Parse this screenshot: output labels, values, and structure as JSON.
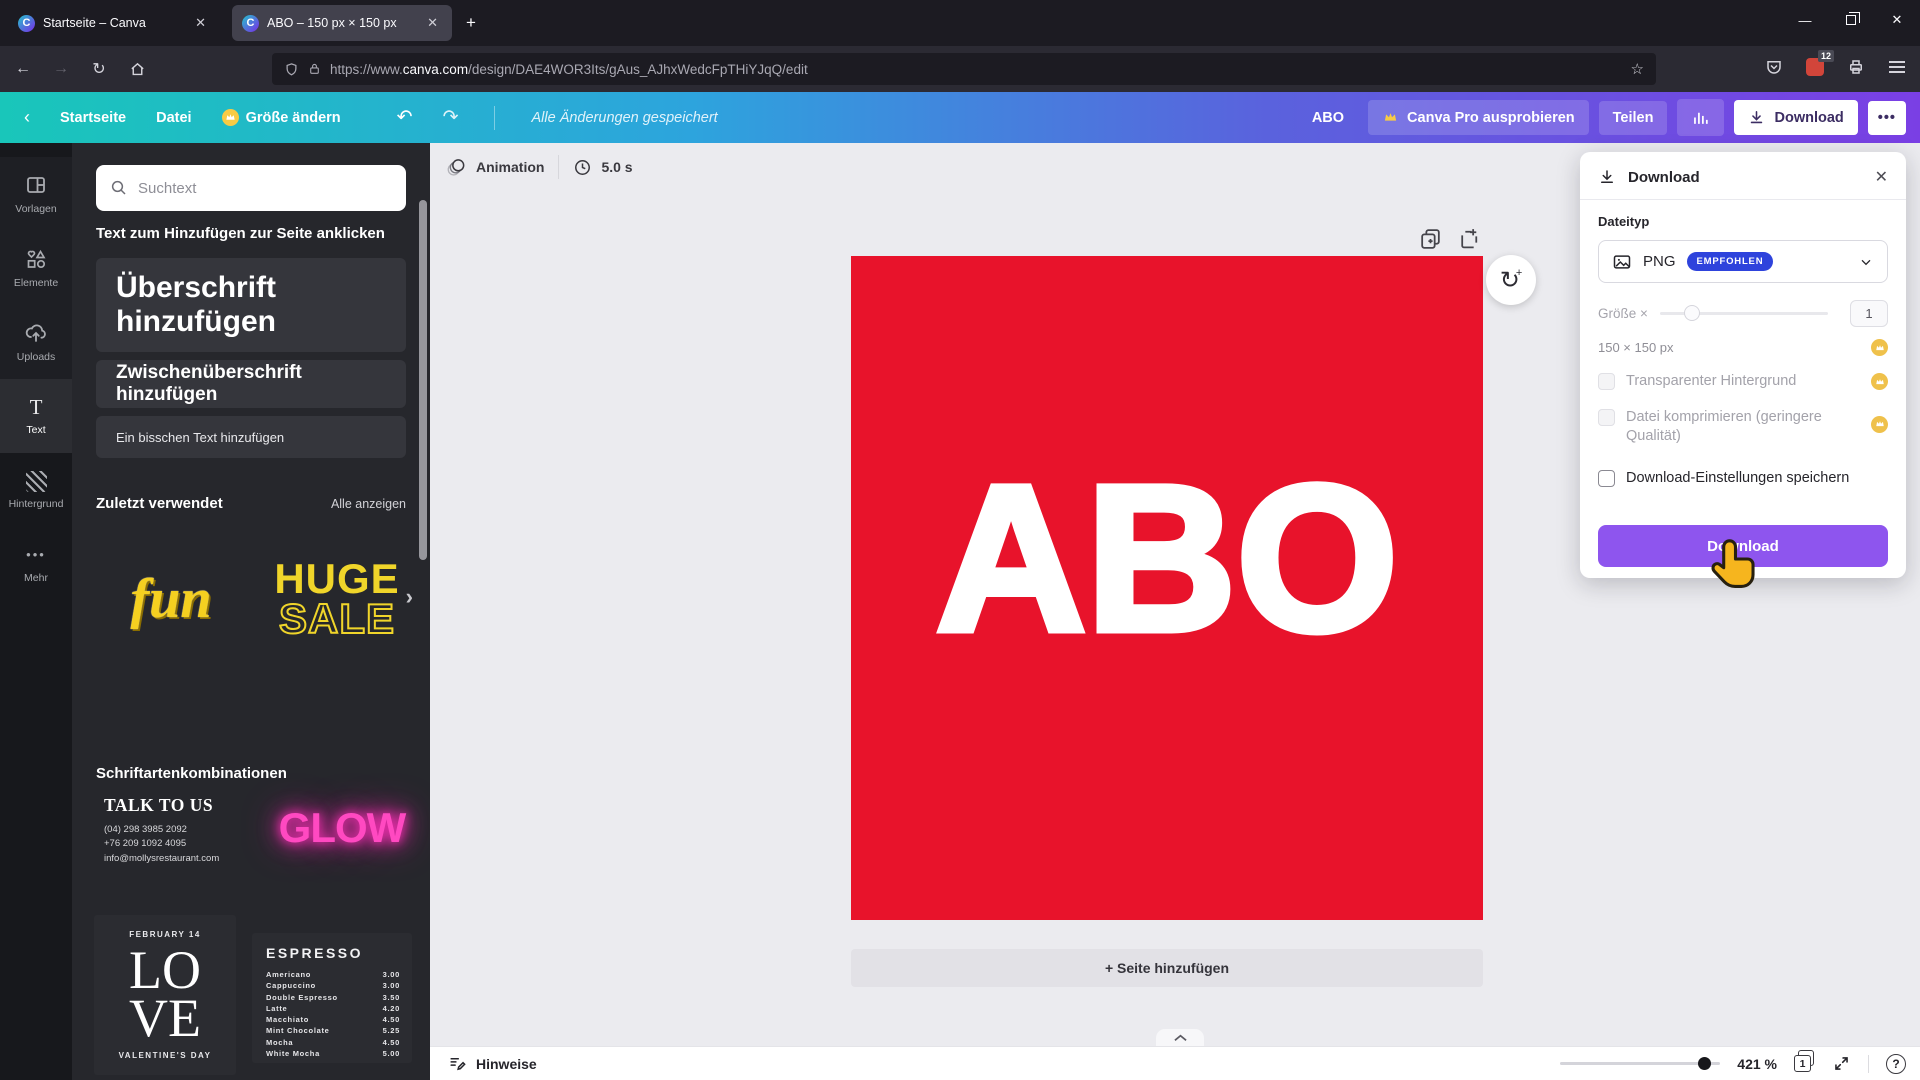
{
  "browser": {
    "tab1": "Startseite – Canva",
    "tab2": "ABO – 150 px × 150 px",
    "url_prefix": "https://www.",
    "url_domain": "canva.com",
    "url_path": "/design/DAE4WOR3Its/gAus_AJhxWedcFpTHiYJqQ/edit",
    "ext_badge": "12"
  },
  "topbar": {
    "home": "Startseite",
    "file": "Datei",
    "resize": "Größe ändern",
    "saved": "Alle Änderungen gespeichert",
    "design_name": "ABO",
    "try_pro": "Canva Pro ausprobieren",
    "share": "Teilen",
    "download": "Download",
    "more": "•••"
  },
  "rail": {
    "items": [
      {
        "label": "Vorlagen"
      },
      {
        "label": "Elemente"
      },
      {
        "label": "Uploads"
      },
      {
        "label": "Text"
      },
      {
        "label": "Hintergrund"
      },
      {
        "label": "Mehr"
      }
    ]
  },
  "panel": {
    "search_placeholder": "Suchtext",
    "hint": "Text zum Hinzufügen zur Seite anklicken",
    "heading_card": "Überschrift hinzufügen",
    "subheading_card": "Zwischenüberschrift hinzufügen",
    "body_card": "Ein bisschen Text hinzufügen",
    "recent_title": "Zuletzt verwendet",
    "show_all": "Alle anzeigen",
    "fun": "fun",
    "huge_line1": "HUGE",
    "huge_line2": "SALE",
    "huge_arrow": "›",
    "combos_title": "Schriftartenkombinationen",
    "talk_title": "TALK TO US",
    "talk_line1": "(04) 298 3985 2092",
    "talk_line2": "+76 209 1092 4095",
    "talk_line3": "info@mollysrestaurant.com",
    "glow": "GLOW",
    "love_top": "FEBRUARY 14",
    "love_l1": "LO",
    "love_l2": "VE",
    "love_bottom": "VALENTINE'S DAY",
    "menu_title": "ESPRESSO",
    "menu": [
      {
        "name": "Americano",
        "price": "3.00"
      },
      {
        "name": "Cappuccino",
        "price": "3.00"
      },
      {
        "name": "Double Espresso",
        "price": "3.50"
      },
      {
        "name": "Latte",
        "price": "4.20"
      },
      {
        "name": "Macchiato",
        "price": "4.50"
      },
      {
        "name": "Mint Chocolate",
        "price": "5.25"
      },
      {
        "name": "Mocha",
        "price": "4.50"
      },
      {
        "name": "White Mocha",
        "price": "5.00"
      }
    ]
  },
  "canvas": {
    "animation": "Animation",
    "duration": "5.0 s",
    "artwork_text": "ABO",
    "add_page": "+ Seite hinzufügen"
  },
  "download_panel": {
    "title": "Download",
    "filetype_label": "Dateityp",
    "filetype_value": "PNG",
    "recommended_badge": "EMPFOHLEN",
    "size_label": "Größe ×",
    "size_value": "1",
    "dimensions": "150 × 150 px",
    "opt_transparent": "Transparenter Hintergrund",
    "opt_compress": "Datei komprimieren (geringere Qualität)",
    "opt_save": "Download-Einstellungen speichern",
    "cta": "Download"
  },
  "statusbar": {
    "notes": "Hinweise",
    "zoom": "421 %",
    "page": "1"
  },
  "colors": {
    "artwork_red": "#e8132b",
    "accent_purple": "#8e55ee",
    "badge_blue": "#2e43dc",
    "crown_gold": "#efc14b",
    "gradient_start": "#19c6ba",
    "gradient_end": "#7a3fe4"
  }
}
